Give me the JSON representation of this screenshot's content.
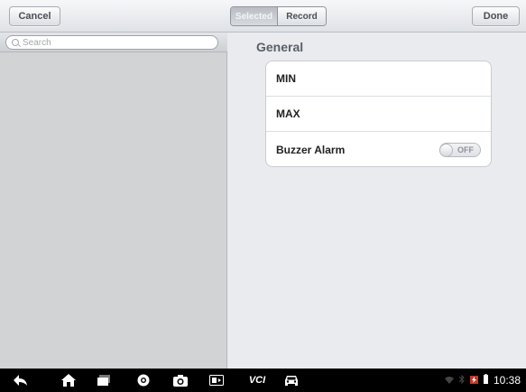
{
  "toolbar": {
    "cancel_label": "Cancel",
    "segment_selected_label": "Selected",
    "segment_record_label": "Record",
    "done_label": "Done"
  },
  "search": {
    "placeholder": "Search"
  },
  "settings": {
    "section_title": "General",
    "rows": [
      {
        "label": "MIN"
      },
      {
        "label": "MAX"
      },
      {
        "label": "Buzzer Alarm",
        "toggle": "OFF"
      }
    ]
  },
  "system_bar": {
    "icons": [
      "back-icon",
      "home-icon",
      "recent-apps-icon",
      "browser-icon",
      "camera-icon",
      "screen-capture-icon",
      "vci-icon",
      "car-icon"
    ],
    "vci_label": "VCI",
    "time": "10:38"
  }
}
